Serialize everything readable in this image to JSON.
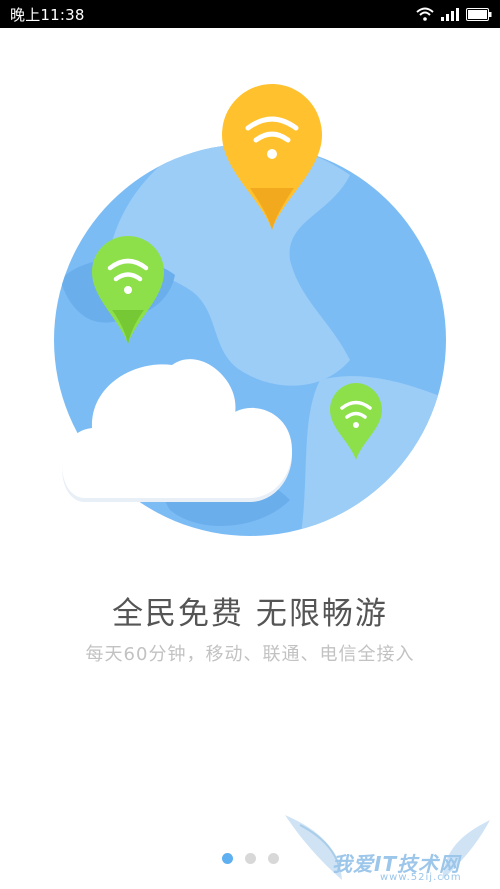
{
  "status_bar": {
    "time": "晚上11:38",
    "wifi_icon": "wifi-icon",
    "signal_icon": "signal-icon",
    "battery_icon": "battery-icon"
  },
  "illustration": {
    "globe_color": "#7cbcf5",
    "land_color": "#9ccdf7",
    "pins": [
      {
        "name": "yellow-wifi-pin",
        "color": "#ffc22e"
      },
      {
        "name": "green-wifi-pin",
        "color": "#8ee04a"
      },
      {
        "name": "small-green-wifi-pin",
        "color": "#8ee04a"
      }
    ]
  },
  "content": {
    "headline": "全民免费 无限畅游",
    "subline": "每天60分钟，移动、联通、电信全接入"
  },
  "pager": {
    "pages": 3,
    "active_index": 0
  },
  "watermark": {
    "text": "我爱IT技术网",
    "url": "www.52ij.com"
  }
}
